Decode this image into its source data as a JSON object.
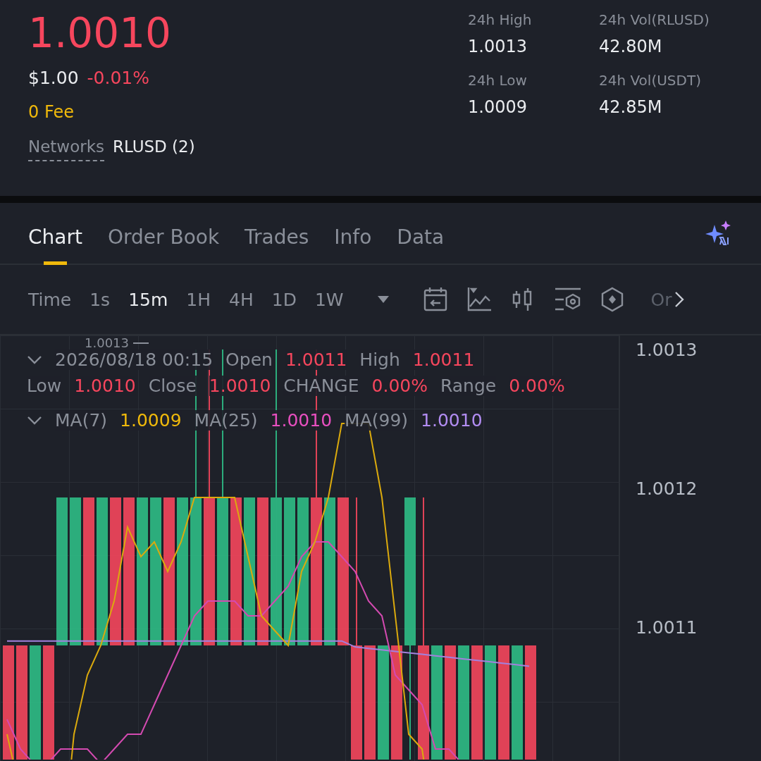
{
  "ticker": {
    "price": "1.0010",
    "usd_price": "$1.00",
    "change": "-0.01%",
    "fee": "0 Fee",
    "networks_label": "Networks",
    "networks_value": "RLUSD (2)"
  },
  "stats": [
    {
      "label": "24h High",
      "value": "1.0013"
    },
    {
      "label": "24h Vol(RLUSD)",
      "value": "42.80M"
    },
    {
      "label": "24h Low",
      "value": "1.0009"
    },
    {
      "label": "24h Vol(USDT)",
      "value": "42.85M"
    }
  ],
  "tabs": [
    {
      "label": "Chart",
      "selected": true
    },
    {
      "label": "Order Book",
      "selected": false
    },
    {
      "label": "Trades",
      "selected": false
    },
    {
      "label": "Info",
      "selected": false
    },
    {
      "label": "Data",
      "selected": false
    }
  ],
  "intervals": [
    {
      "label": "Time",
      "selected": false
    },
    {
      "label": "1s",
      "selected": false
    },
    {
      "label": "15m",
      "selected": true
    },
    {
      "label": "1H",
      "selected": false
    },
    {
      "label": "4H",
      "selected": false
    },
    {
      "label": "1D",
      "selected": false
    },
    {
      "label": "1W",
      "selected": false
    }
  ],
  "more_label": "Or",
  "chart": {
    "max_marker": "1.0013",
    "datetime": "2026/08/18 00:15",
    "fields": [
      {
        "label": "Open",
        "value": "1.0011"
      },
      {
        "label": "High",
        "value": "1.0011"
      },
      {
        "label": "Low",
        "value": "1.0010"
      },
      {
        "label": "Close",
        "value": "1.0010"
      },
      {
        "label": "CHANGE",
        "value": "0.00%"
      },
      {
        "label": "Range",
        "value": "0.00%"
      }
    ],
    "ma": [
      {
        "label": "MA(7)",
        "value": "1.0009",
        "color": "#f0b90b"
      },
      {
        "label": "MA(25)",
        "value": "1.0010",
        "color": "#e84fc0"
      },
      {
        "label": "MA(99)",
        "value": "1.0010",
        "color": "#b28cf2"
      }
    ],
    "price_axis": [
      "1.0013",
      "1.0012",
      "1.0011"
    ]
  }
}
